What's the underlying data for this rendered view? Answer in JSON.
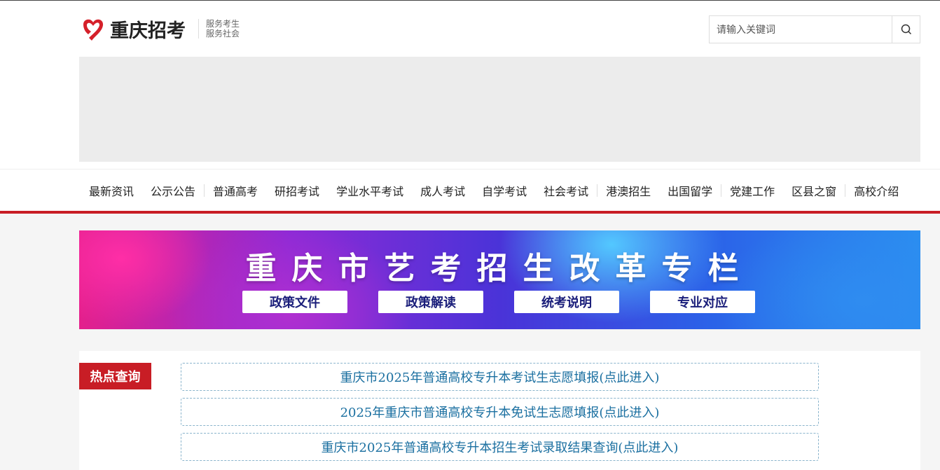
{
  "header": {
    "logo_text": "重庆招考",
    "slogan_line1": "服务考生",
    "slogan_line2": "服务社会",
    "search_placeholder": "请输入关键词"
  },
  "nav": {
    "items": [
      "最新资讯",
      "公示公告",
      "普通高考",
      "研招考试",
      "学业水平考试",
      "成人考试",
      "自学考试",
      "社会考试",
      "港澳招生",
      "出国留学",
      "党建工作",
      "区县之窗",
      "高校介绍"
    ]
  },
  "banner": {
    "title": "重庆市艺考招生改革专栏",
    "buttons": [
      "政策文件",
      "政策解读",
      "统考说明",
      "专业对应"
    ]
  },
  "hot": {
    "label": "热点查询",
    "links": [
      "重庆市2025年普通高校专升本考试生志愿填报(点此进入)",
      "2025年重庆市普通高校专升本免试生志愿填报(点此进入)",
      "重庆市2025年普通高校专升本招生考试录取结果查询(点此进入)"
    ]
  },
  "colors": {
    "brand_red": "#c81d25",
    "link_blue": "#1a6fa0",
    "banner_button_text": "#1a1e7a"
  }
}
